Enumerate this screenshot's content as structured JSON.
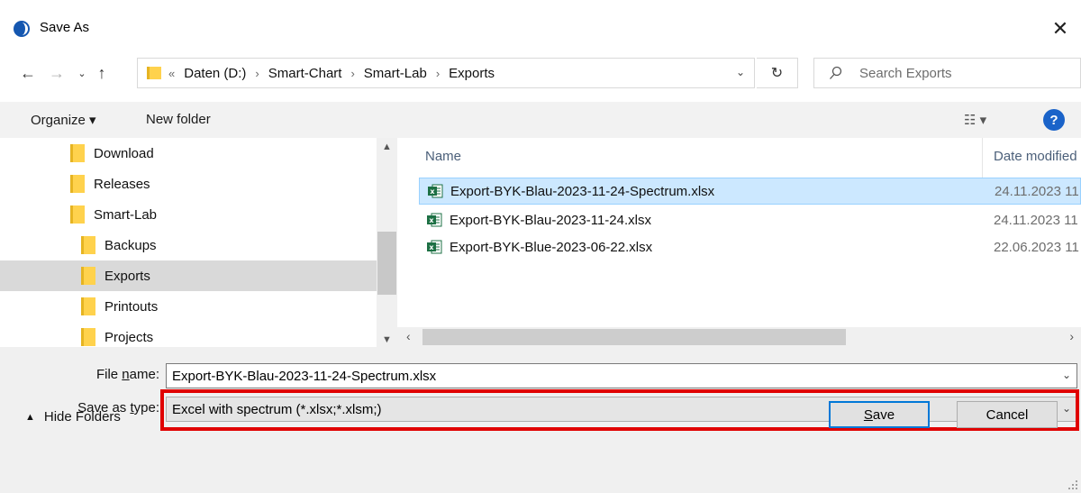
{
  "window": {
    "title": "Save As",
    "close_glyph": "✕"
  },
  "navigation": {
    "breadcrumbs": [
      "Daten (D:)",
      "Smart-Chart",
      "Smart-Lab",
      "Exports"
    ],
    "overflow": "«",
    "separator": "›",
    "search_placeholder": "Search Exports"
  },
  "toolbar": {
    "organize_label": "Organize ▾",
    "new_folder_label": "New folder",
    "view_label": "☷ ▾",
    "help_label": "?"
  },
  "tree": {
    "items": [
      {
        "label": "Download",
        "indent": 1,
        "selected": false
      },
      {
        "label": "Releases",
        "indent": 1,
        "selected": false
      },
      {
        "label": "Smart-Lab",
        "indent": 1,
        "selected": false
      },
      {
        "label": "Backups",
        "indent": 2,
        "selected": false
      },
      {
        "label": "Exports",
        "indent": 2,
        "selected": true
      },
      {
        "label": "Printouts",
        "indent": 2,
        "selected": false
      },
      {
        "label": "Projects",
        "indent": 2,
        "selected": false
      }
    ]
  },
  "files": {
    "columns": {
      "name": "Name",
      "date": "Date modified"
    },
    "rows": [
      {
        "name": "Export-BYK-Blau-2023-11-24-Spectrum.xlsx",
        "date": "24.11.2023 11",
        "selected": true
      },
      {
        "name": "Export-BYK-Blau-2023-11-24.xlsx",
        "date": "24.11.2023 11",
        "selected": false
      },
      {
        "name": "Export-BYK-Blue-2023-06-22.xlsx",
        "date": "22.06.2023 11",
        "selected": false
      }
    ]
  },
  "form": {
    "file_name_label_pre": "File ",
    "file_name_label_key": "n",
    "file_name_label_post": "ame:",
    "file_name_value": "Export-BYK-Blau-2023-11-24-Spectrum.xlsx",
    "save_type_label_pre": "Save as ",
    "save_type_label_key": "t",
    "save_type_label_post": "ype:",
    "save_type_value": "Excel with spectrum (*.xlsx;*.xlsm;)",
    "hide_folders_label": "Hide Folders",
    "save_label_key": "S",
    "save_label_rest": "ave",
    "cancel_label": "Cancel"
  },
  "colors": {
    "accent": "#0078d7",
    "highlight_border": "#e00000",
    "selection_bg": "#cce8ff",
    "folder_yellow": "#ffd24d",
    "excel_green": "#1d7044"
  }
}
